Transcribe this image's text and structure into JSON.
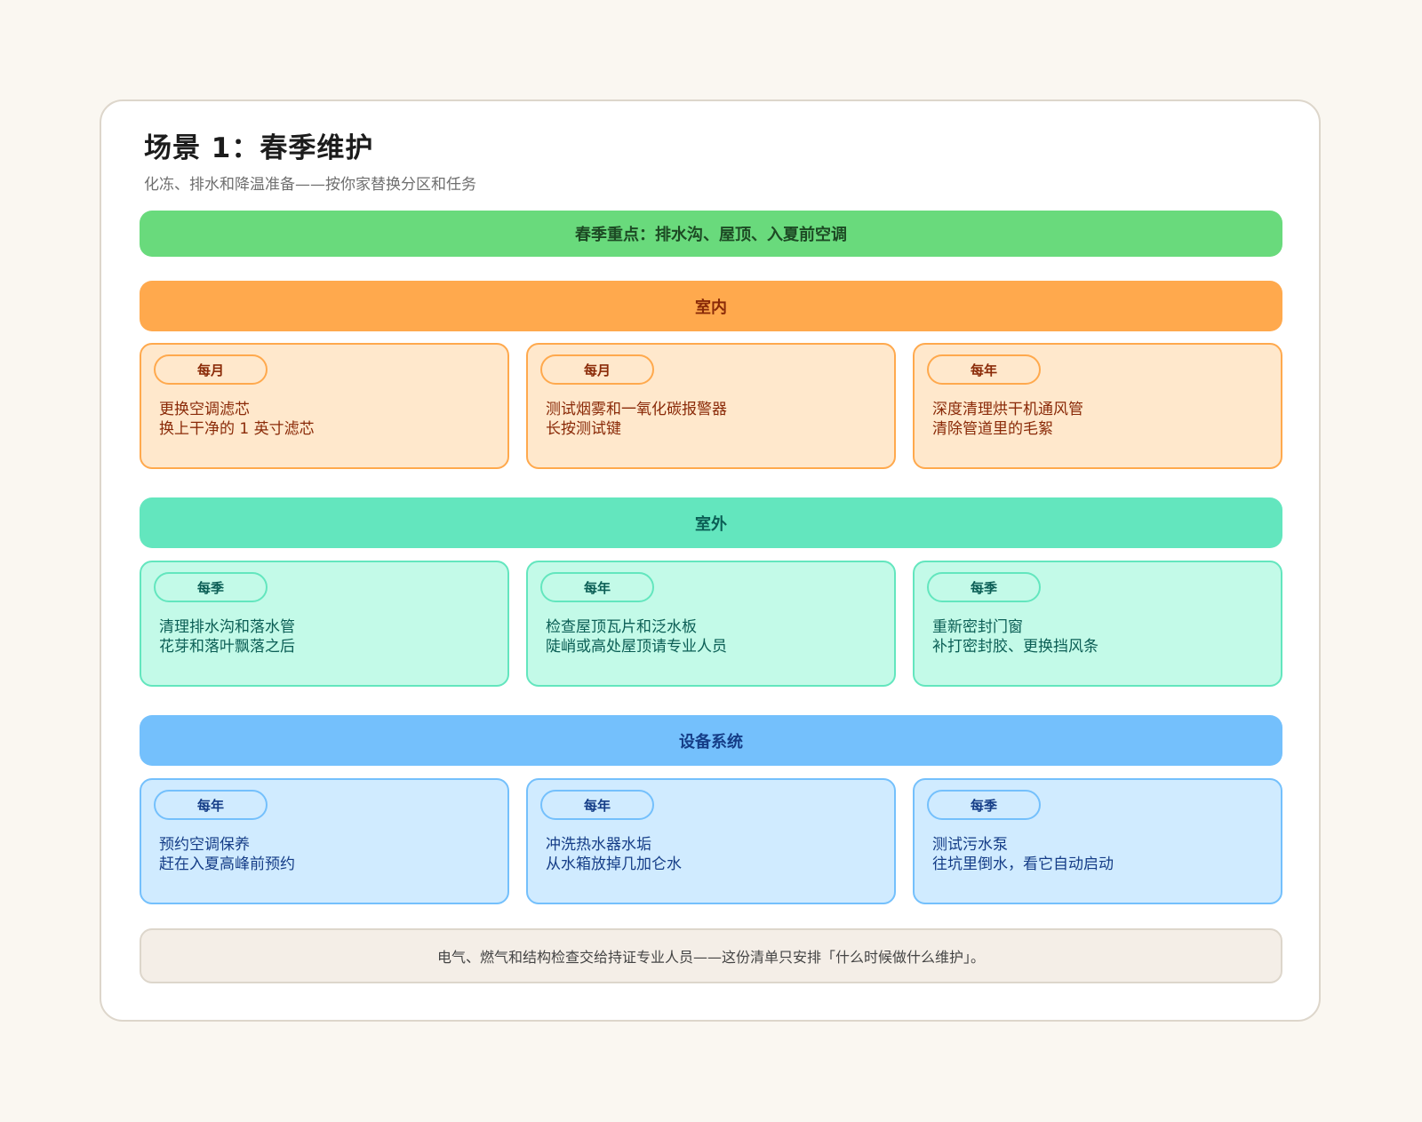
{
  "header": {
    "title": "场景 1：春季维护",
    "subtitle": "化冻、排水和降温准备——按你家替换分区和任务"
  },
  "focus_banner": "春季重点：排水沟、屋顶、入夏前空调",
  "sections": [
    {
      "label": "室内",
      "color": "#ffa94d",
      "tasks": [
        {
          "badge": "每月",
          "title": "更换空调滤芯",
          "detail": "换上干净的 1 英寸滤芯"
        },
        {
          "badge": "每月",
          "title": "测试烟雾和一氧化碳报警器",
          "detail": "长按测试键"
        },
        {
          "badge": "每年",
          "title": "深度清理烘干机通风管",
          "detail": "清除管道里的毛絮"
        }
      ]
    },
    {
      "label": "室外",
      "color": "#63e6be",
      "tasks": [
        {
          "badge": "每季",
          "title": "清理排水沟和落水管",
          "detail": "花芽和落叶飘落之后"
        },
        {
          "badge": "每年",
          "title": "检查屋顶瓦片和泛水板",
          "detail": "陡峭或高处屋顶请专业人员"
        },
        {
          "badge": "每季",
          "title": "重新密封门窗",
          "detail": "补打密封胶、更换挡风条"
        }
      ]
    },
    {
      "label": "设备系统",
      "color": "#74c0fc",
      "tasks": [
        {
          "badge": "每年",
          "title": "预约空调保养",
          "detail": "赶在入夏高峰前预约"
        },
        {
          "badge": "每年",
          "title": "冲洗热水器水垢",
          "detail": "从水箱放掉几加仑水"
        },
        {
          "badge": "每季",
          "title": "测试污水泵",
          "detail": "往坑里倒水，看它自动启动"
        }
      ]
    }
  ],
  "footer_note": "电气、燃气和结构检查交给持证专业人员——这份清单只安排「什么时候做什么维护」。"
}
